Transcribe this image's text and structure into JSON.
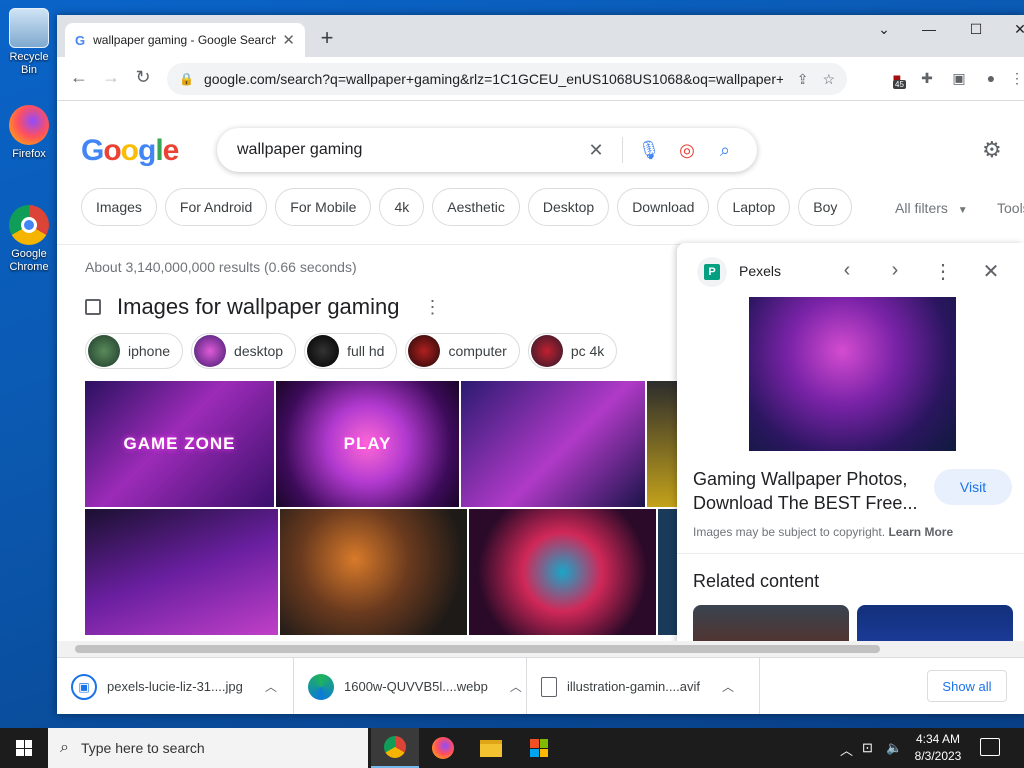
{
  "desktop": {
    "icons": [
      {
        "label": "Recycle Bin",
        "icon": "recycle-bin-icon"
      },
      {
        "label": "Firefox",
        "icon": "firefox-icon"
      },
      {
        "label": "Google Chrome",
        "icon": "chrome-icon"
      }
    ]
  },
  "browser": {
    "tab_title": "wallpaper gaming - Google Search",
    "url": "google.com/search?q=wallpaper+gaming&rlz=1C1GCEU_enUS1068US1068&oq=wallpaper+ga...",
    "extension_badge": "45"
  },
  "google": {
    "logo": "Google",
    "query": "wallpaper gaming",
    "chips": [
      "Images",
      "For Android",
      "For Mobile",
      "4k",
      "Aesthetic",
      "Desktop",
      "Download",
      "Laptop",
      "Boy"
    ],
    "all_filters": "All filters",
    "tools": "Tools",
    "stats": "About 3,140,000,000 results (0.66 seconds)",
    "images_heading": "Images for wallpaper gaming",
    "suggestions": [
      "iphone",
      "desktop",
      "full hd",
      "computer",
      "pc 4k"
    ],
    "tile_labels": [
      "GAME ZONE",
      "PLAY"
    ]
  },
  "panel": {
    "source": "Pexels",
    "title": "Gaming Wallpaper Photos, Download The BEST Free...",
    "visit": "Visit",
    "copyright": "Images may be subject to copyright.",
    "learn_more": "Learn More",
    "related": "Related content"
  },
  "downloads": {
    "items": [
      "pexels-lucie-liz-31....jpg",
      "1600w-QUVVB5l....webp",
      "illustration-gamin....avif"
    ],
    "show_all": "Show all"
  },
  "taskbar": {
    "search_placeholder": "Type here to search",
    "time": "4:34 AM",
    "date": "8/3/2023"
  }
}
